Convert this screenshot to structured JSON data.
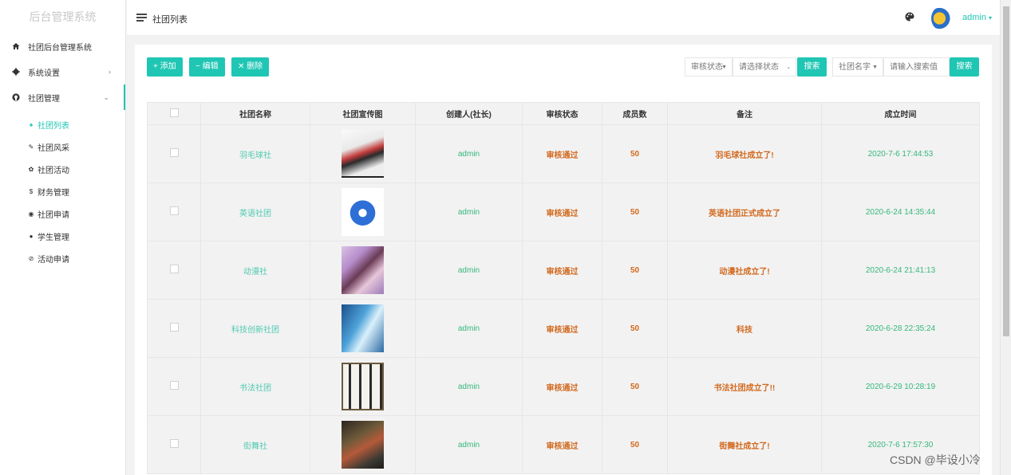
{
  "app": {
    "title": "后台管理系统"
  },
  "sidebar": {
    "items": [
      {
        "label": "社团后台管理系统",
        "icon": "home-icon"
      },
      {
        "label": "系统设置",
        "icon": "gear-icon",
        "arrow": "›"
      },
      {
        "label": "社团管理",
        "icon": "github-icon",
        "arrow": "⌄"
      }
    ],
    "sub_items": [
      {
        "label": "社团列表",
        "icon": "home-icon",
        "glyph": "♠",
        "active": true
      },
      {
        "label": "社团风采",
        "icon": "pen-icon",
        "glyph": "✎"
      },
      {
        "label": "社团活动",
        "icon": "gear-icon",
        "glyph": "✿"
      },
      {
        "label": "财务管理",
        "icon": "dollar-icon",
        "glyph": "$"
      },
      {
        "label": "社团申请",
        "icon": "earth-icon",
        "glyph": "◉"
      },
      {
        "label": "学生管理",
        "icon": "user-icon",
        "glyph": "●"
      },
      {
        "label": "活动申请",
        "icon": "settings-icon",
        "glyph": "⊘"
      }
    ]
  },
  "header": {
    "title": "社团列表",
    "user": "admin",
    "user_arrow": "▾"
  },
  "toolbar": {
    "add": "+ 添加",
    "edit": "− 编辑",
    "delete": "✕ 删除",
    "status_filter": "审核状态",
    "status_select_placeholder": "请选择状态",
    "search1": "搜索",
    "name_filter": "社团名字",
    "search_placeholder": "请输入搜索值",
    "search2": "搜索"
  },
  "table": {
    "headers": [
      "社团名称",
      "社团宣传图",
      "创建人(社长)",
      "审核状态",
      "成员数",
      "备注",
      "成立时间"
    ],
    "rows": [
      {
        "name": "羽毛球社",
        "creator": "admin",
        "status": "审核通过",
        "members": "50",
        "note": "羽毛球社成立了!",
        "time": "2020-7-6 17:44:53"
      },
      {
        "name": "英语社团",
        "creator": "admin",
        "status": "审核通过",
        "members": "50",
        "note": "英语社团正式成立了",
        "time": "2020-6-24 14:35:44"
      },
      {
        "name": "动漫社",
        "creator": "admin",
        "status": "审核通过",
        "members": "50",
        "note": "动漫社成立了!",
        "time": "2020-6-24 21:41:13"
      },
      {
        "name": "科技创新社团",
        "creator": "admin",
        "status": "审核通过",
        "members": "50",
        "note": "科技",
        "time": "2020-6-28 22:35:24"
      },
      {
        "name": "书法社团",
        "creator": "admin",
        "status": "审核通过",
        "members": "50",
        "note": "书法社团成立了!!",
        "time": "2020-6-29 10:28:19"
      },
      {
        "name": "街舞社",
        "creator": "admin",
        "status": "审核通过",
        "members": "50",
        "note": "街舞社成立了!",
        "time": "2020-7-6 17:57:30"
      }
    ]
  },
  "watermark": "CSDN @毕设小冷",
  "colors": {
    "accent": "#1fc6b4",
    "green": "#35b87d",
    "orange": "#d2691e"
  }
}
